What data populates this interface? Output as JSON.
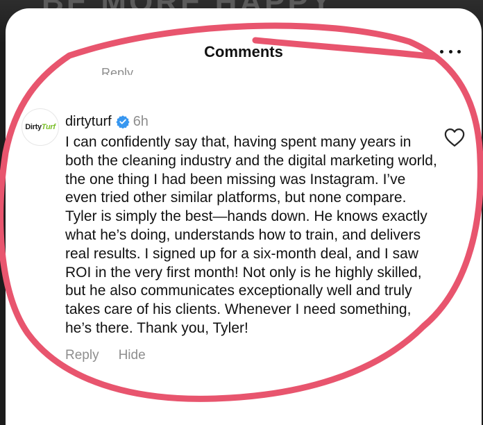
{
  "background": {
    "text": "BE MORE HAPPY"
  },
  "header": {
    "title": "Comments"
  },
  "previous_comment": {
    "reply_label": "Reply"
  },
  "comment": {
    "avatar_text_a": "Dirty",
    "avatar_text_b": "Turf",
    "username": "dirtyturf",
    "time": "6h",
    "text": "I can confidently say that, having spent many years in both the cleaning industry and the digital marketing world, the one thing I had been missing was Instagram. I’ve even tried other similar platforms, but none compare. Tyler is simply the best—hands down. He knows exactly what he’s doing, understands how to train, and delivers real results. I signed up for a six-month deal, and I saw ROI in the very first month! Not only is he highly skilled, but he also communicates exceptionally well and truly takes care of his clients. Whenever I need something, he’s there. Thank you, Tyler!",
    "reply_label": "Reply",
    "hide_label": "Hide"
  },
  "colors": {
    "verified": "#3897f0",
    "annotation": "#e8556e",
    "secondary_text": "#8e8e8e"
  },
  "icons": [
    "more-icon",
    "verified-badge-icon",
    "heart-icon"
  ]
}
